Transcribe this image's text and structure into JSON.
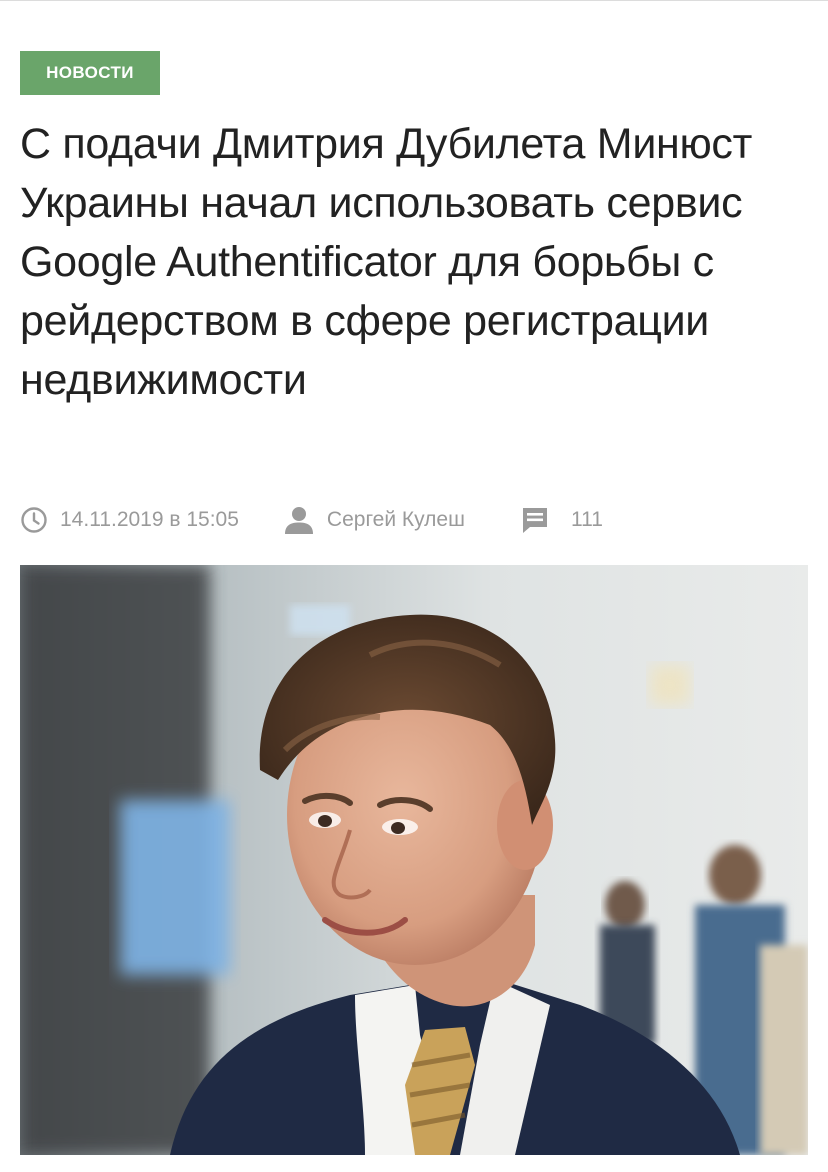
{
  "article": {
    "category": "НОВОСТИ",
    "headline": "С подачи Дмитрия Дубилета Минюст Украины начал использовать сервис Google Authentificator для борьбы с рейдерством в сфере регистрации недвижимости",
    "meta": {
      "date": "14.11.2019 в 15:05",
      "author": "Сергей Кулеш",
      "comments": "111"
    },
    "photo": {
      "icon": "portrait-photo"
    }
  },
  "icons": {
    "date": "clock-icon",
    "author": "user-icon",
    "comments": "comment-icon"
  },
  "colors": {
    "badge": "#6aa56a",
    "headline": "#222222",
    "meta": "#9a9a9a",
    "suit": "#1f2a44",
    "tie": "#c9a25a"
  }
}
